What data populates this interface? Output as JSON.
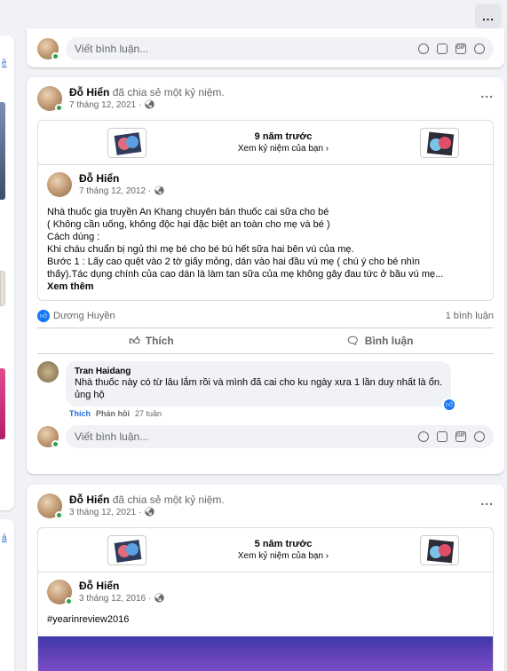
{
  "top_more_label": "...",
  "comment_placeholder": "Viết bình luận...",
  "post1": {
    "author": "Đỗ Hiển",
    "action": "đã chia sẻ một kỷ niệm.",
    "date": "7 tháng 12, 2021 ·",
    "more": "...",
    "memory_years": "9 năm trước",
    "memory_view": "Xem kỷ niệm của bạn ›",
    "inner_author": "Đỗ Hiển",
    "inner_date": "7 tháng 12, 2012 ·",
    "body_lines": [
      "Nhà thuốc gia truyền An Khang chuyên bán thuốc cai sữa cho bé",
      "( Không cần uống, không độc hại đặc biệt an toàn cho mẹ và bé )",
      "Cách dùng :",
      "Khi cháu chuẩn bị ngủ thì mẹ bé cho bé bú hết sữa hai bên vú của mẹ.",
      "Bước 1 : Lấy cao quệt vào 2 tờ giấy mỏng, dán vào hai đầu vú mẹ ( chú ý cho bé nhìn",
      "thấy).Tác dụng chính của cao dán là làm tan sữa của mẹ không gây đau tức ở bầu vú mẹ..."
    ],
    "see_more": "Xem thêm",
    "reactor": "Dương Huyền",
    "comment_count": "1 bình luận",
    "like_label": "Thích",
    "comment_label": "Bình luận",
    "comment": {
      "author": "Tran Haidang",
      "text_line1": "Nhà thuốc này có từ lâu lắm rồi và mình đã cai cho ku ngày xưa 1 lần duy nhất là ổn.",
      "text_line2": "ủng hộ",
      "like": "Thích",
      "reply": "Phản hồi",
      "time": "27 tuần"
    }
  },
  "post2": {
    "author": "Đỗ Hiển",
    "action": "đã chia sẻ một kỷ niệm.",
    "date": "3 tháng 12, 2021 ·",
    "more": "...",
    "memory_years": "5 năm trước",
    "memory_view": "Xem kỷ niệm của bạn ›",
    "inner_author": "Đỗ Hiển",
    "inner_date": "3 tháng 12, 2016 ·",
    "body": "#yearinreview2016"
  },
  "sidebar_links": [
    "ề",
    "ả"
  ],
  "colors": {
    "accent": "#1877f2",
    "online": "#31a24c",
    "bg": "#f0f2f5"
  }
}
